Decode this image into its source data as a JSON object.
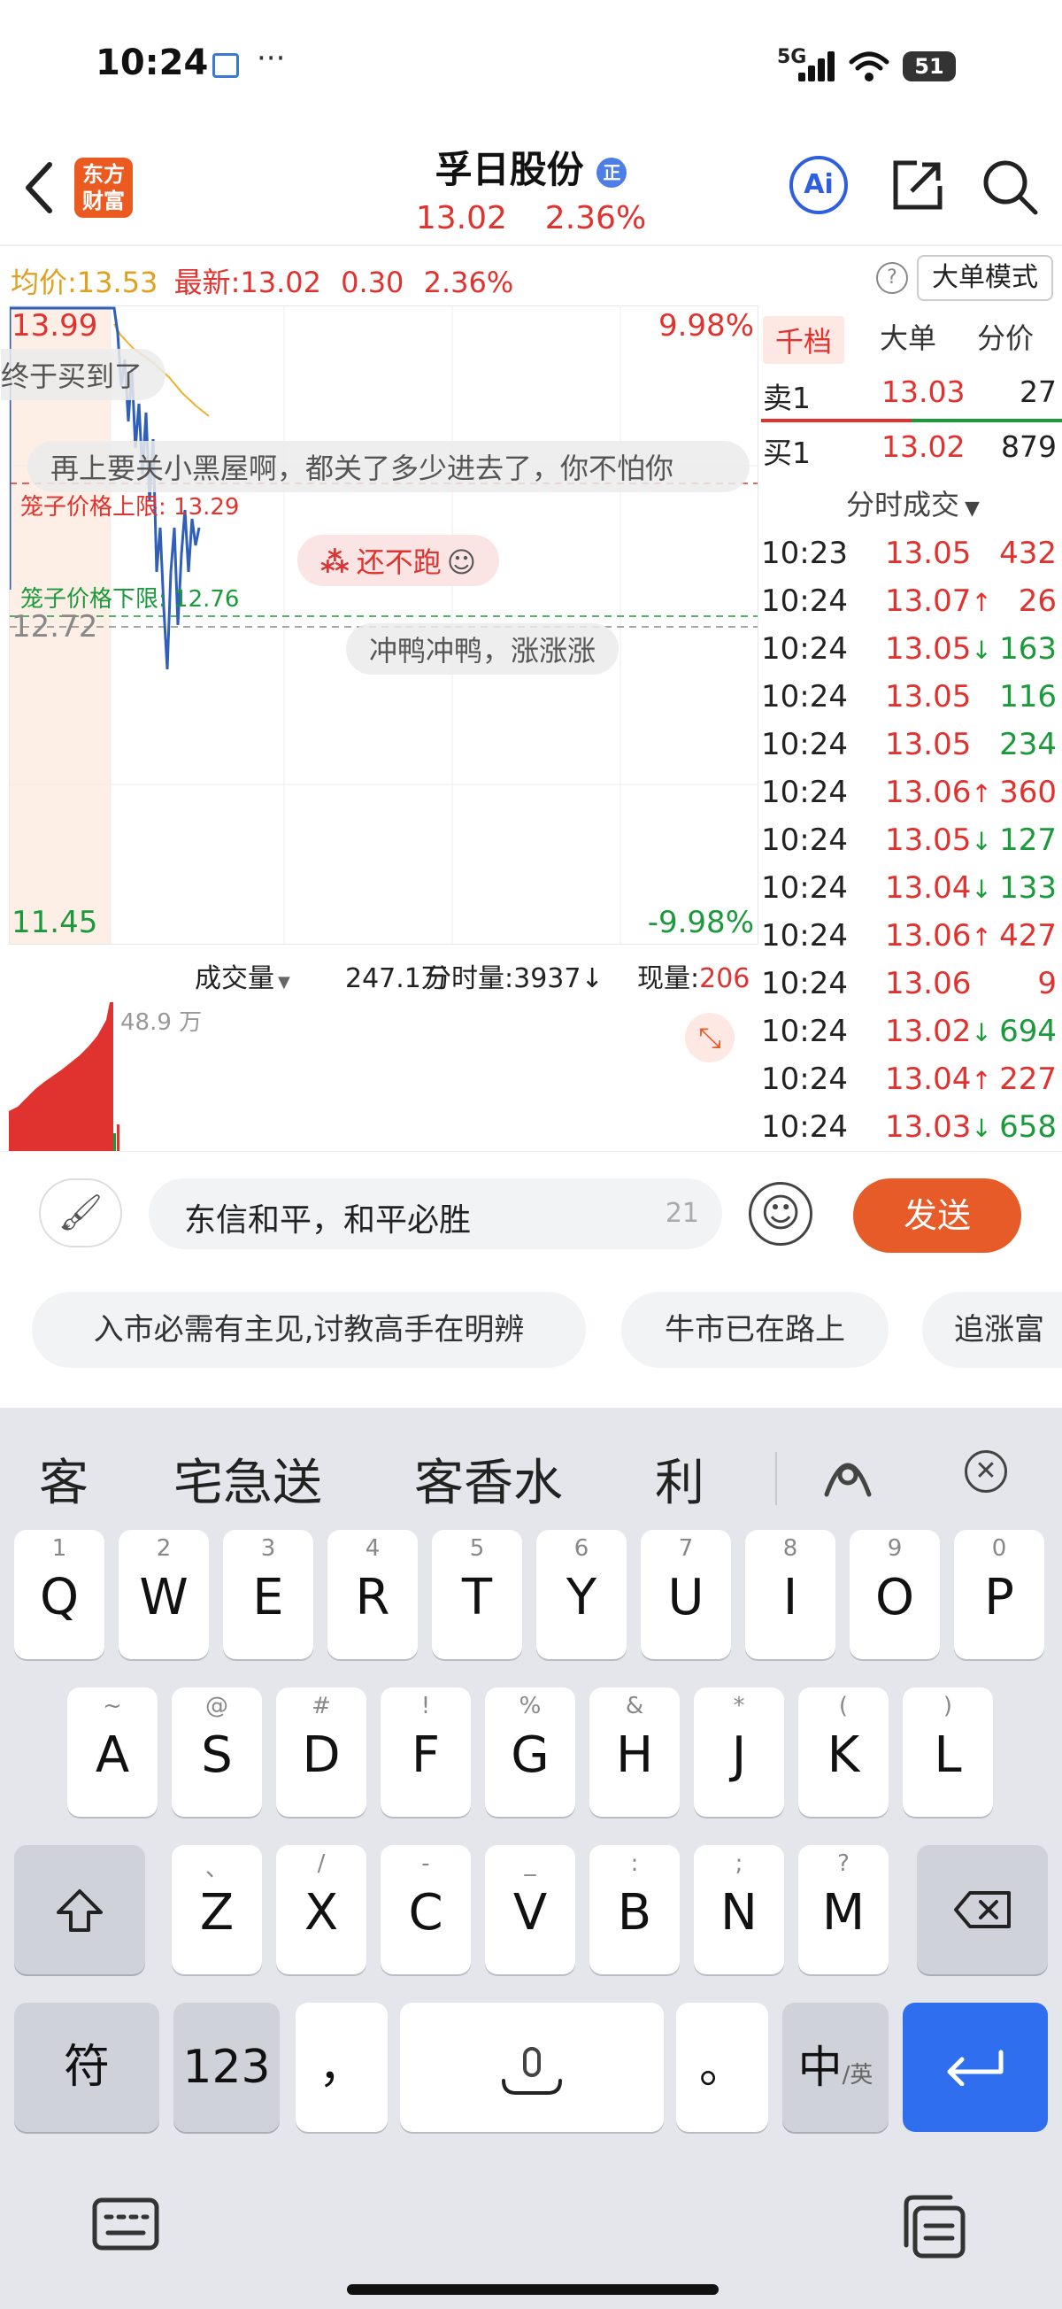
{
  "status_bar": {
    "time": "10:24",
    "network": "5G",
    "battery": "51"
  },
  "header": {
    "logo_text": "东方\n财富",
    "stock_name": "孚日股份",
    "badge": "正",
    "price": "13.02",
    "change_pct": "2.36%",
    "ai_label": "Ai"
  },
  "info": {
    "avg_label": "均价:",
    "avg_value": "13.53",
    "latest_label": "最新:",
    "latest_value": "13.02",
    "change": "0.30",
    "change_pct": "2.36%",
    "mode_button": "大单模式"
  },
  "chart": {
    "price_high": "13.99",
    "pct_high": "9.98%",
    "price_low": "11.45",
    "pct_low": "-9.98%",
    "ref_price": "12.72",
    "cage_upper_label": "笼子价格上限: 13.29",
    "cage_lower_label": "笼子价格下限: 12.76",
    "vol_scale": "48.9 万"
  },
  "danmu": [
    "终于买到了",
    "再上要关小黑屋啊，都关了多少进去了，你不怕你",
    "还不跑",
    "冲鸭冲鸭，涨涨涨"
  ],
  "volume_bar": {
    "label": "成交量",
    "total": "247.1万",
    "minute_label": "分时量:3937",
    "minute_arrow": "↓",
    "current_label": "现量:",
    "current_value": "206"
  },
  "right_panel": {
    "tabs": [
      "千档",
      "大单",
      "分价"
    ],
    "sell1": {
      "label": "卖1",
      "price": "13.03",
      "vol": "27"
    },
    "buy1": {
      "label": "买1",
      "price": "13.02",
      "vol": "879"
    },
    "ticks_title": "分时成交",
    "ticks": [
      {
        "time": "10:23",
        "price": "13.05",
        "arrow": "",
        "vol": "432",
        "dir": "up"
      },
      {
        "time": "10:24",
        "price": "13.07",
        "arrow": "↑",
        "vol": "26",
        "dir": "up"
      },
      {
        "time": "10:24",
        "price": "13.05",
        "arrow": "↓",
        "vol": "163",
        "dir": "down"
      },
      {
        "time": "10:24",
        "price": "13.05",
        "arrow": "",
        "vol": "116",
        "dir": "down"
      },
      {
        "time": "10:24",
        "price": "13.05",
        "arrow": "",
        "vol": "234",
        "dir": "down"
      },
      {
        "time": "10:24",
        "price": "13.06",
        "arrow": "↑",
        "vol": "360",
        "dir": "up"
      },
      {
        "time": "10:24",
        "price": "13.05",
        "arrow": "↓",
        "vol": "127",
        "dir": "down"
      },
      {
        "time": "10:24",
        "price": "13.04",
        "arrow": "↓",
        "vol": "133",
        "dir": "down"
      },
      {
        "time": "10:24",
        "price": "13.06",
        "arrow": "↑",
        "vol": "427",
        "dir": "up"
      },
      {
        "time": "10:24",
        "price": "13.06",
        "arrow": "",
        "vol": "9",
        "dir": "up"
      },
      {
        "time": "10:24",
        "price": "13.02",
        "arrow": "↓",
        "vol": "694",
        "dir": "down"
      },
      {
        "time": "10:24",
        "price": "13.04",
        "arrow": "↑",
        "vol": "227",
        "dir": "up"
      },
      {
        "time": "10:24",
        "price": "13.03",
        "arrow": "↓",
        "vol": "658",
        "dir": "down"
      }
    ]
  },
  "input": {
    "text": "东信和平，和平必胜",
    "count": "21",
    "send_label": "发送"
  },
  "quick_phrases": [
    "入市必需有主见,讨教高手在明辨",
    "牛市已在路上",
    "追涨富"
  ],
  "keyboard": {
    "candidates": [
      "客",
      "宅急送",
      "客香水",
      "利"
    ],
    "row1": [
      {
        "letter": "Q",
        "num": "1"
      },
      {
        "letter": "W",
        "num": "2"
      },
      {
        "letter": "E",
        "num": "3"
      },
      {
        "letter": "R",
        "num": "4"
      },
      {
        "letter": "T",
        "num": "5"
      },
      {
        "letter": "Y",
        "num": "6"
      },
      {
        "letter": "U",
        "num": "7"
      },
      {
        "letter": "I",
        "num": "8"
      },
      {
        "letter": "O",
        "num": "9"
      },
      {
        "letter": "P",
        "num": "0"
      }
    ],
    "row2": [
      {
        "letter": "A",
        "num": "~"
      },
      {
        "letter": "S",
        "num": "@"
      },
      {
        "letter": "D",
        "num": "#"
      },
      {
        "letter": "F",
        "num": "!"
      },
      {
        "letter": "G",
        "num": "%"
      },
      {
        "letter": "H",
        "num": "&"
      },
      {
        "letter": "J",
        "num": "*"
      },
      {
        "letter": "K",
        "num": "("
      },
      {
        "letter": "L",
        "num": ")"
      }
    ],
    "row3": [
      {
        "letter": "Z",
        "num": "、"
      },
      {
        "letter": "X",
        "num": "/"
      },
      {
        "letter": "C",
        "num": "-"
      },
      {
        "letter": "V",
        "num": "_"
      },
      {
        "letter": "B",
        "num": ":"
      },
      {
        "letter": "N",
        "num": ";"
      },
      {
        "letter": "M",
        "num": "?"
      }
    ],
    "symbol_key": "符",
    "num_key": "123",
    "comma_key": "，",
    "period_key": "。",
    "lang_key_main": "中",
    "lang_key_sub": "/英"
  },
  "colors": {
    "up": "#e0322e",
    "down": "#1b9a3c",
    "accent": "#e65b27",
    "enter": "#2f6fef"
  }
}
